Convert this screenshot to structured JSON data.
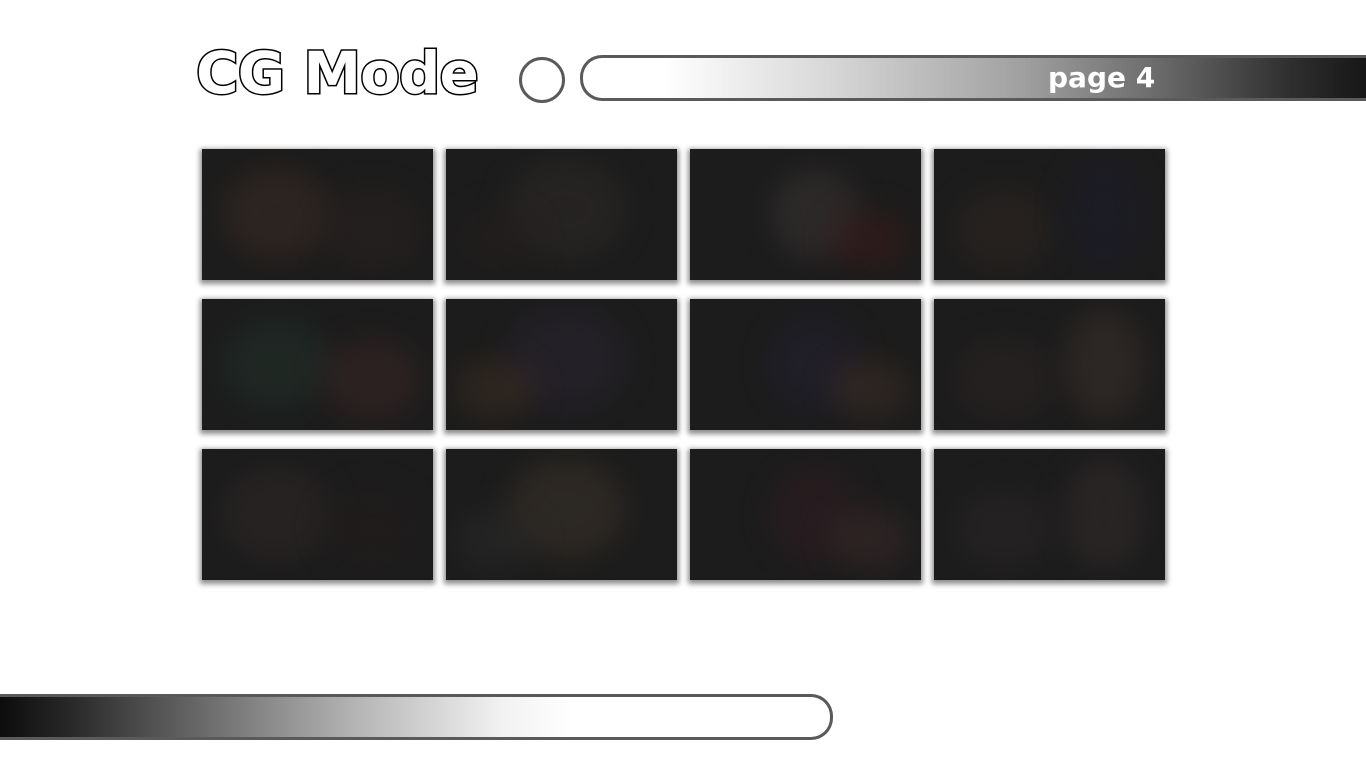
{
  "title": "CG Mode",
  "pager": {
    "label": "page 4"
  },
  "colors": {
    "thumb_base": "#1c1c1c",
    "bar_border": "#5a5a5a",
    "title_stroke": "#000000"
  },
  "thumbnails": [
    {
      "name": "cg-thumb-1",
      "tint": [
        "#3a2c26",
        "#2a2220"
      ]
    },
    {
      "name": "cg-thumb-2",
      "tint": [
        "#2e2a28",
        "#241f1d"
      ]
    },
    {
      "name": "cg-thumb-3",
      "tint": [
        "#3a3434",
        "#3a1a1a"
      ]
    },
    {
      "name": "cg-thumb-4",
      "tint": [
        "#2e2623",
        "#1c1c2a"
      ]
    },
    {
      "name": "cg-thumb-5",
      "tint": [
        "#22302a",
        "#3a2626"
      ]
    },
    {
      "name": "cg-thumb-6",
      "tint": [
        "#2a2430",
        "#3a2e22"
      ]
    },
    {
      "name": "cg-thumb-7",
      "tint": [
        "#242030",
        "#3a2e28"
      ]
    },
    {
      "name": "cg-thumb-8",
      "tint": [
        "#2c2424",
        "#3a302c"
      ]
    },
    {
      "name": "cg-thumb-9",
      "tint": [
        "#302828",
        "#221c1c"
      ]
    },
    {
      "name": "cg-thumb-10",
      "tint": [
        "#3a322a",
        "#2a2a2a"
      ]
    },
    {
      "name": "cg-thumb-11",
      "tint": [
        "#301c22",
        "#3a2a2a"
      ]
    },
    {
      "name": "cg-thumb-12",
      "tint": [
        "#2a2626",
        "#342c2c"
      ]
    }
  ]
}
